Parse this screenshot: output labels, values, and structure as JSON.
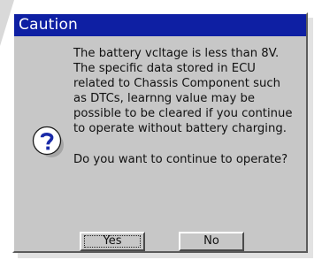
{
  "dialog": {
    "title": "Caution",
    "message_lines": [
      "The battery vcltage is less than 8V.",
      "The specific data stored in ECU",
      "related to Chassis Component such",
      "as DTCs, learnng value may be",
      "possible to be cleared if you continue",
      "to operate without battery charging."
    ],
    "question": "Do you want to continue to operate?",
    "icon": "question-icon",
    "buttons": {
      "yes": "Yes",
      "no": "No"
    }
  },
  "colors": {
    "titlebar": "#0e1fa3",
    "dialog_bg": "#c7c7c7",
    "icon_blue": "#1a2aa8"
  }
}
